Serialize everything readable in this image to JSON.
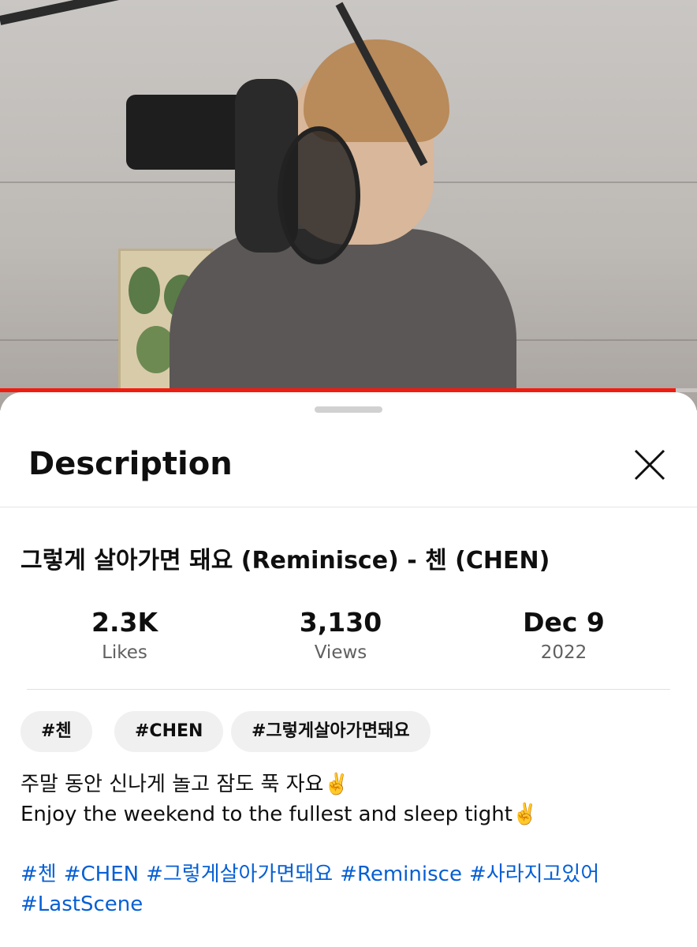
{
  "video": {
    "progress_percent": 97
  },
  "sheet": {
    "title": "Description",
    "video_title": "그렇게 살아가면 돼요 (Reminisce) - 첸 (CHEN)",
    "stats": [
      {
        "value": "2.3K",
        "label": "Likes"
      },
      {
        "value": "3,130",
        "label": "Views"
      },
      {
        "value": "Dec 9",
        "label": "2022"
      }
    ],
    "chips": [
      "#첸",
      "#CHEN",
      "#그렇게살아가면돼요"
    ],
    "description_lines": [
      "주말 동안 신나게 놀고 잠도 푹 자요✌️",
      "Enjoy the weekend to the fullest and sleep tight✌️"
    ],
    "hashtags": [
      "#첸",
      "#CHEN",
      "#그렇게살아가면돼요",
      "#Reminisce",
      "#사라지고있어",
      "#LastScene"
    ]
  },
  "colors": {
    "progress": "#f11c10",
    "hashtag": "#065fd4",
    "chip_bg": "#f0f0f0"
  }
}
